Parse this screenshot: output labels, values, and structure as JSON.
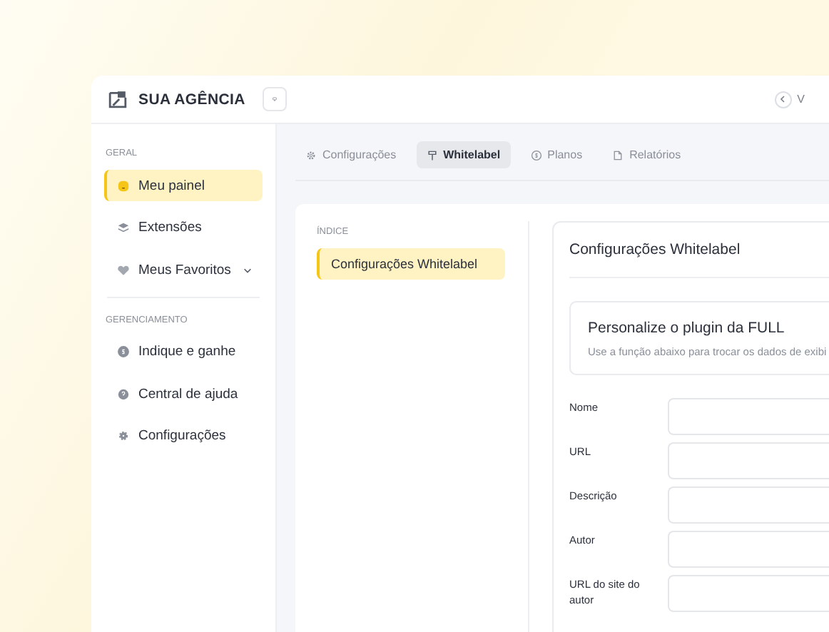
{
  "header": {
    "brand": "SUA AGÊNCIA",
    "back_label": "V"
  },
  "sidebar": {
    "sections": [
      {
        "title": "GERAL",
        "items": [
          {
            "label": "Meu painel",
            "kind": "face",
            "selected": true,
            "expandable": false
          },
          {
            "label": "Extensões",
            "kind": "layers",
            "selected": false,
            "expandable": false
          },
          {
            "label": "Meus Favoritos",
            "kind": "heart",
            "selected": false,
            "expandable": true
          }
        ]
      },
      {
        "title": "GERENCIAMENTO",
        "items": [
          {
            "label": "Indique e ganhe",
            "kind": "coin",
            "selected": false,
            "expandable": false
          },
          {
            "label": "Central de ajuda",
            "kind": "help",
            "selected": false,
            "expandable": false
          },
          {
            "label": "Configurações",
            "kind": "gear",
            "selected": false,
            "expandable": false
          }
        ]
      }
    ]
  },
  "tabs": [
    {
      "label": "Configurações",
      "kind": "gear",
      "selected": false
    },
    {
      "label": "Whitelabel",
      "kind": "brush",
      "selected": true
    },
    {
      "label": "Planos",
      "kind": "coin",
      "selected": false
    },
    {
      "label": "Relatórios",
      "kind": "doc",
      "selected": false
    }
  ],
  "index": {
    "title": "ÍNDICE",
    "items": [
      {
        "label": "Configurações Whitelabel",
        "selected": true
      }
    ]
  },
  "panel": {
    "title": "Configurações Whitelabel",
    "intro": {
      "title": "Personalize o plugin da FULL",
      "text": "Use a função abaixo para trocar os dados de exibi"
    },
    "fields": [
      {
        "label": "Nome"
      },
      {
        "label": "URL"
      },
      {
        "label": "Descrição"
      },
      {
        "label": "Autor"
      },
      {
        "label": "URL do site do autor"
      }
    ]
  }
}
